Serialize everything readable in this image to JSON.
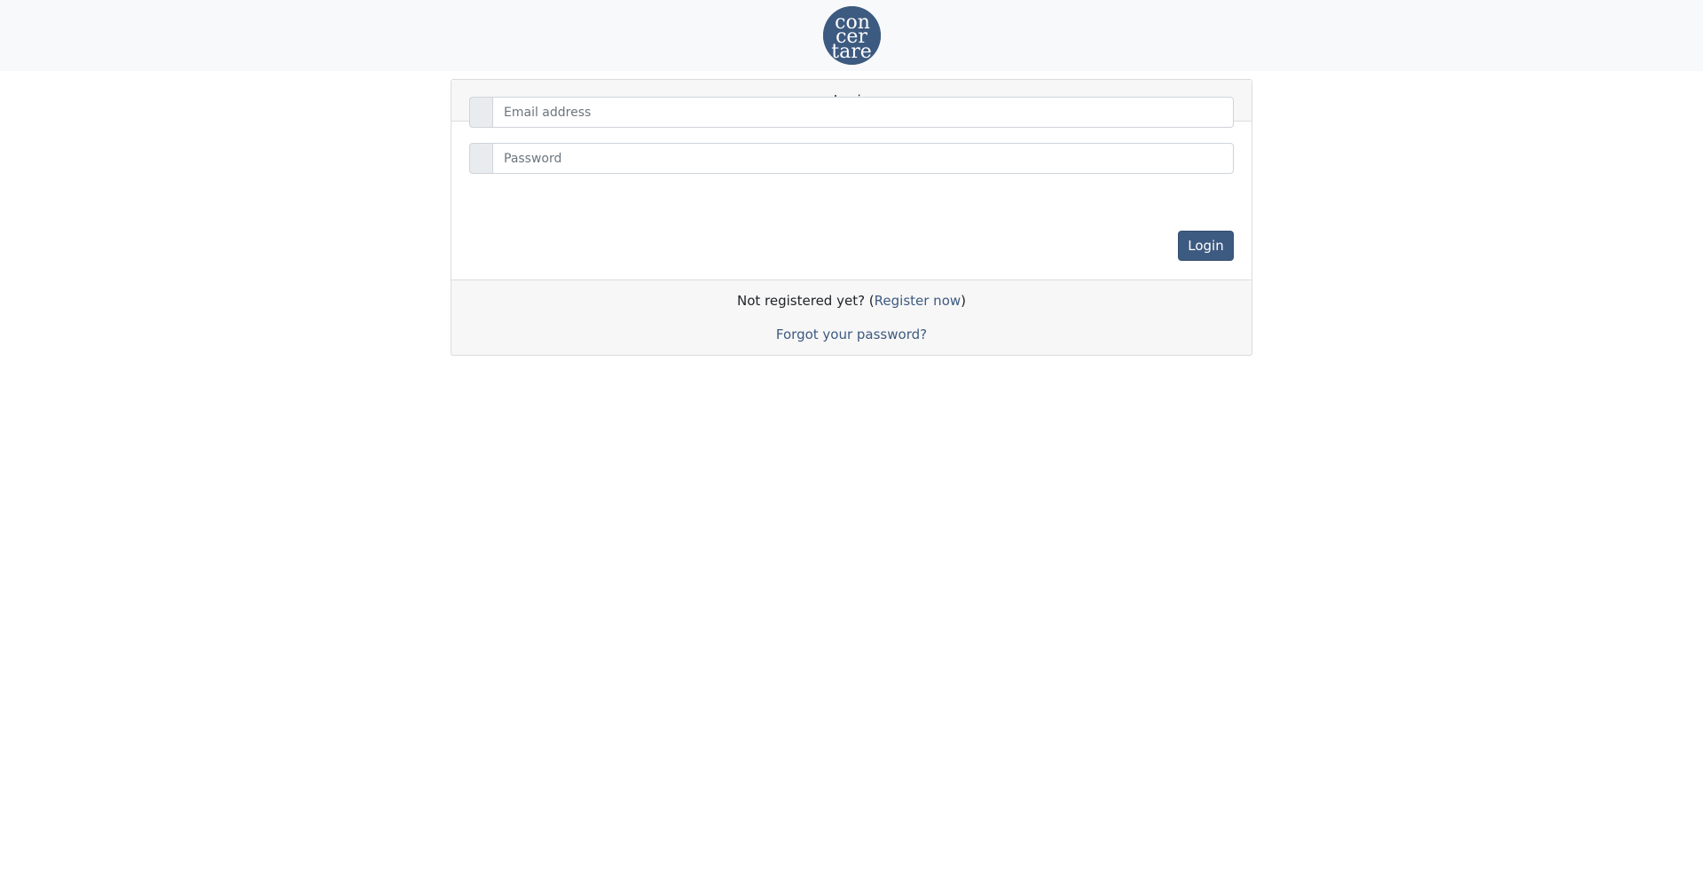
{
  "header": {
    "logo_text": [
      "con",
      "cer",
      "tare"
    ],
    "logo_color": "#3d5a80"
  },
  "login_card": {
    "title": "Login",
    "email": {
      "placeholder": "Email address",
      "value": "",
      "icon": "envelope-icon"
    },
    "password": {
      "placeholder": "Password",
      "value": "",
      "icon": "lock-icon"
    },
    "submit_label": "Login"
  },
  "footer": {
    "register_prefix": "Not registered yet? (",
    "register_link": "Register now",
    "register_suffix": ")",
    "forgot_link": "Forgot your password?"
  },
  "colors": {
    "accent": "#3d5a80",
    "card_header_bg": "#f7f7f7",
    "topbar_bg": "#f8f9fa"
  }
}
